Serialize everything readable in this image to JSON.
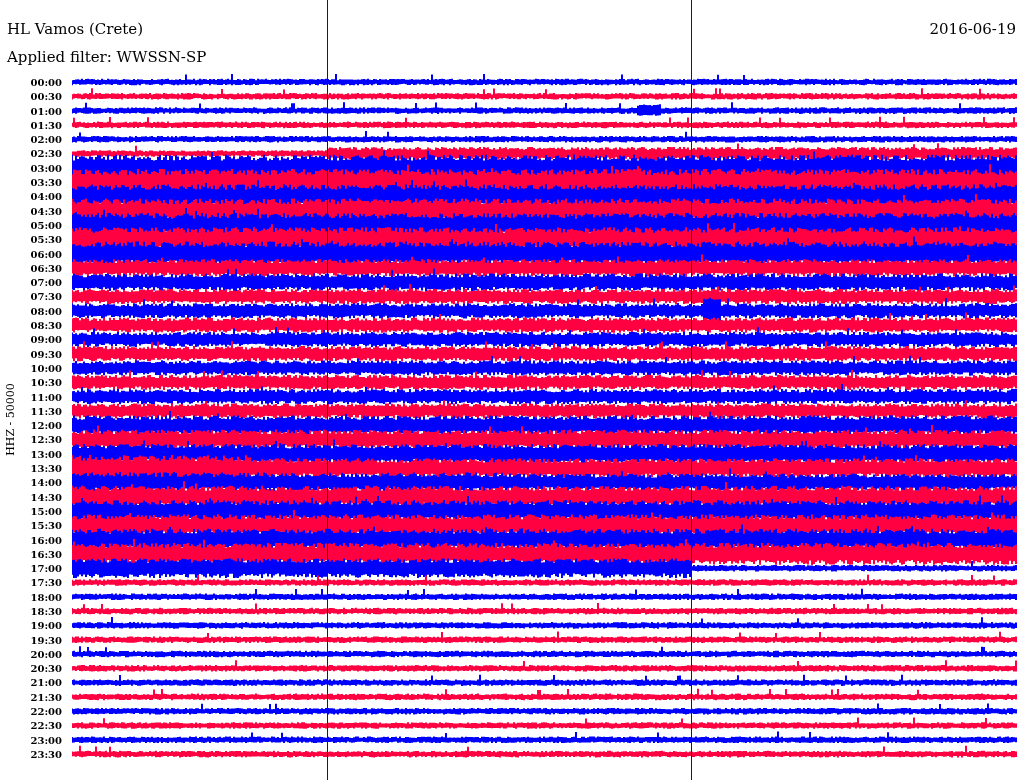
{
  "header": {
    "station": "HL Vamos (Crete)",
    "date": "2016-06-19",
    "filter": "Applied filter: WWSSN-SP"
  },
  "axis_label": "HHZ - 50000",
  "rows": [
    {
      "time": "00:00",
      "color": "#0000ff"
    },
    {
      "time": "00:30",
      "color": "#ff0040"
    },
    {
      "time": "01:00",
      "color": "#0000ff"
    },
    {
      "time": "01:30",
      "color": "#ff0040"
    },
    {
      "time": "02:00",
      "color": "#0000ff"
    },
    {
      "time": "02:30",
      "color": "#ff0040"
    },
    {
      "time": "03:00",
      "color": "#0000ff"
    },
    {
      "time": "03:30",
      "color": "#ff0040"
    },
    {
      "time": "04:00",
      "color": "#0000ff"
    },
    {
      "time": "04:30",
      "color": "#ff0040"
    },
    {
      "time": "05:00",
      "color": "#0000ff"
    },
    {
      "time": "05:30",
      "color": "#ff0040"
    },
    {
      "time": "06:00",
      "color": "#0000ff"
    },
    {
      "time": "06:30",
      "color": "#ff0040"
    },
    {
      "time": "07:00",
      "color": "#0000ff"
    },
    {
      "time": "07:30",
      "color": "#ff0040"
    },
    {
      "time": "08:00",
      "color": "#0000ff"
    },
    {
      "time": "08:30",
      "color": "#ff0040"
    },
    {
      "time": "09:00",
      "color": "#0000ff"
    },
    {
      "time": "09:30",
      "color": "#ff0040"
    },
    {
      "time": "10:00",
      "color": "#0000ff"
    },
    {
      "time": "10:30",
      "color": "#ff0040"
    },
    {
      "time": "11:00",
      "color": "#0000ff"
    },
    {
      "time": "11:30",
      "color": "#ff0040"
    },
    {
      "time": "12:00",
      "color": "#0000ff"
    },
    {
      "time": "12:30",
      "color": "#ff0040"
    },
    {
      "time": "13:00",
      "color": "#0000ff"
    },
    {
      "time": "13:30",
      "color": "#ff0040"
    },
    {
      "time": "14:00",
      "color": "#0000ff"
    },
    {
      "time": "14:30",
      "color": "#ff0040"
    },
    {
      "time": "15:00",
      "color": "#0000ff"
    },
    {
      "time": "15:30",
      "color": "#ff0040"
    },
    {
      "time": "16:00",
      "color": "#0000ff"
    },
    {
      "time": "16:30",
      "color": "#ff0040"
    },
    {
      "time": "17:00",
      "color": "#0000ff"
    },
    {
      "time": "17:30",
      "color": "#ff0040"
    },
    {
      "time": "18:00",
      "color": "#0000ff"
    },
    {
      "time": "18:30",
      "color": "#ff0040"
    },
    {
      "time": "19:00",
      "color": "#0000ff"
    },
    {
      "time": "19:30",
      "color": "#ff0040"
    },
    {
      "time": "20:00",
      "color": "#0000ff"
    },
    {
      "time": "20:30",
      "color": "#ff0040"
    },
    {
      "time": "21:00",
      "color": "#0000ff"
    },
    {
      "time": "21:30",
      "color": "#ff0040"
    },
    {
      "time": "22:00",
      "color": "#0000ff"
    },
    {
      "time": "22:30",
      "color": "#ff0040"
    },
    {
      "time": "23:00",
      "color": "#0000ff"
    },
    {
      "time": "23:30",
      "color": "#ff0040"
    }
  ]
}
